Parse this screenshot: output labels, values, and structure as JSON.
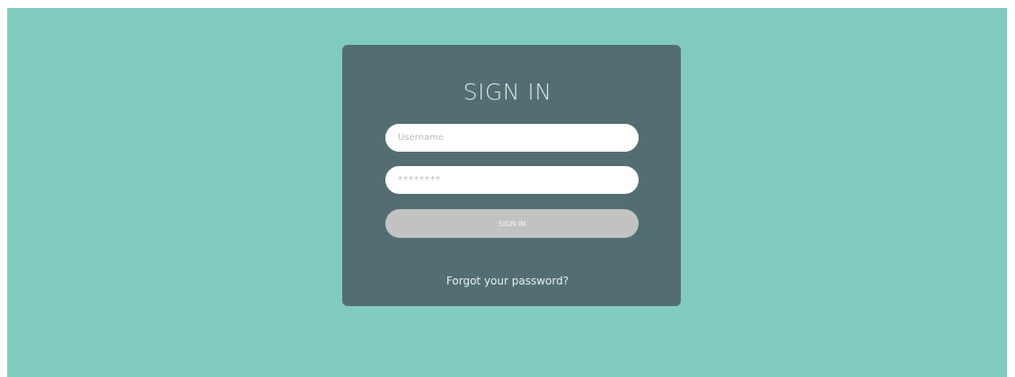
{
  "colors": {
    "page_background": "#81cabf",
    "card_background": "#536e72",
    "button_background": "#c2c2c2",
    "input_background": "#ffffff",
    "title_text": "#d9e6e6"
  },
  "login": {
    "title": "SIGN IN",
    "username_placeholder": "Username",
    "password_placeholder": "********",
    "submit_label": "SIGN IN",
    "forgot_link": "Forgot your password?"
  }
}
